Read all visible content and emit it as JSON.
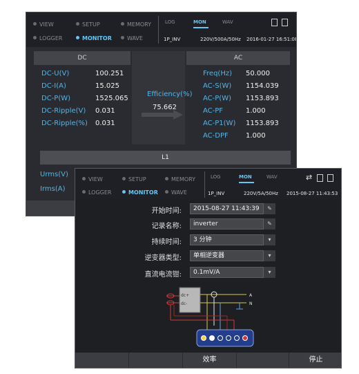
{
  "screen1": {
    "mode_tabs": [
      "VIEW",
      "SETUP",
      "MEMORY",
      "LOGGER",
      "MONITOR",
      "WAVE"
    ],
    "log_tabs": [
      "LOG",
      "MON",
      "WAV"
    ],
    "status": {
      "mode": "1P_INV",
      "range": "220V/500A/50Hz",
      "datetime": "2016-01-27 16:51:08"
    },
    "dc_header": "DC",
    "ac_header": "AC",
    "dc": [
      {
        "label": "DC-U(V)",
        "value": "100.251"
      },
      {
        "label": "DC-I(A)",
        "value": "15.025"
      },
      {
        "label": "DC-P(W)",
        "value": "1525.065"
      },
      {
        "label": "DC-Ripple(V)",
        "value": "0.031"
      },
      {
        "label": "DC-Ripple(%)",
        "value": "0.031"
      }
    ],
    "efficiency": {
      "label": "Efficiency(%)",
      "value": "75.662"
    },
    "ac": [
      {
        "label": "Freq(Hz)",
        "value": "50.000"
      },
      {
        "label": "AC-S(W)",
        "value": "1154.039"
      },
      {
        "label": "AC-P(W)",
        "value": "1153.893"
      },
      {
        "label": "AC-PF",
        "value": "1.000"
      },
      {
        "label": "AC-P1(W)",
        "value": "1153.893"
      },
      {
        "label": "AC-DPF",
        "value": "1.000"
      }
    ],
    "l1_header": "L1",
    "l1_rows": [
      "Urms(V)",
      "Irms(A)"
    ]
  },
  "screen2": {
    "mode_tabs": [
      "VIEW",
      "SETUP",
      "MEMORY",
      "LOGGER",
      "MONITOR",
      "WAVE"
    ],
    "log_tabs": [
      "LOG",
      "MON",
      "WAV"
    ],
    "status": {
      "mode": "1P_INV",
      "range": "220V/5A/50Hz",
      "datetime": "2015-08-27 11:43:53"
    },
    "form": [
      {
        "label": "开始时间:",
        "value": "2015-08-27 11:43:39"
      },
      {
        "label": "记录名称:",
        "value": "inverter"
      },
      {
        "label": "持续时间:",
        "value": "3 分钟"
      },
      {
        "label": "逆变器类型:",
        "value": "单相逆变器"
      },
      {
        "label": "直流电流钳:",
        "value": "0.1mV/A"
      }
    ],
    "wiring": {
      "dc_plus": "dc+",
      "dc_minus": "dc-",
      "phase": "A",
      "neutral": "N"
    },
    "buttons": {
      "efficiency": "效率",
      "stop": "停止"
    }
  }
}
